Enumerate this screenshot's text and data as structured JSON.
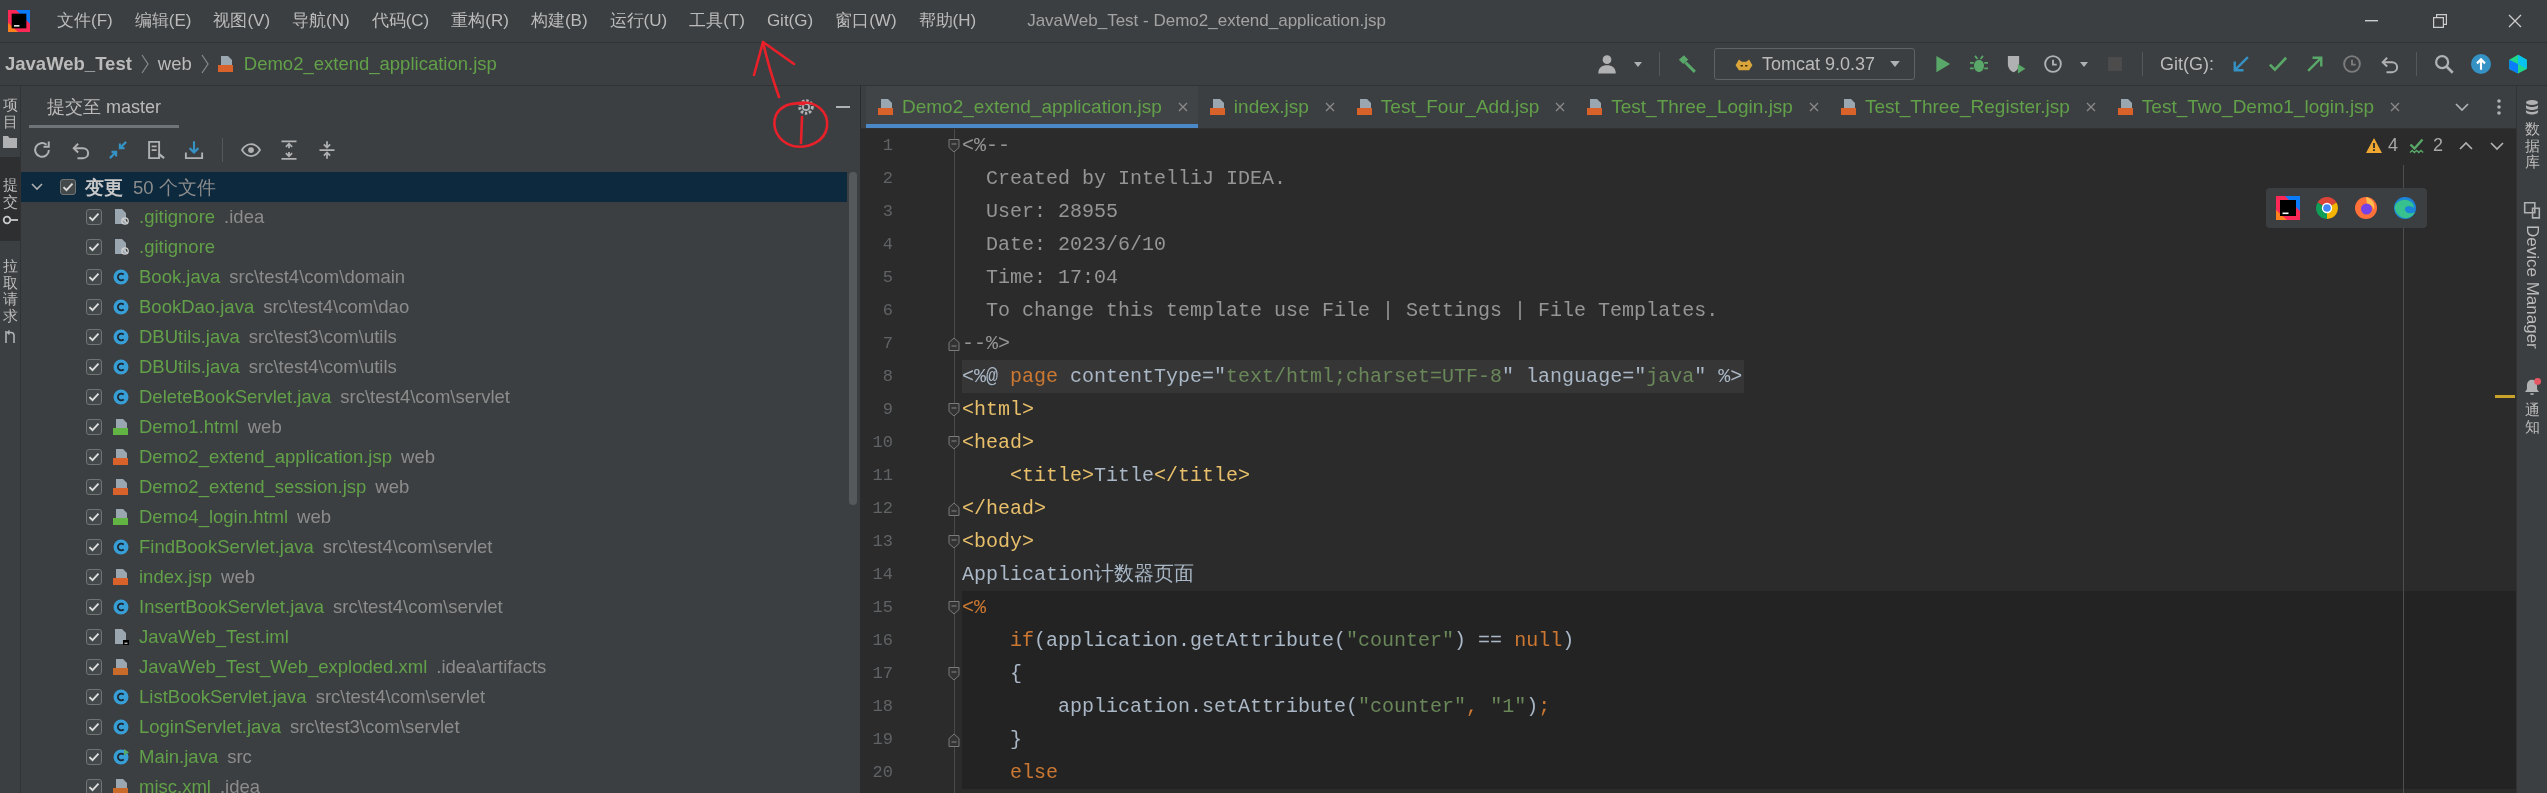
{
  "window": {
    "title": "JavaWeb_Test - Demo2_extend_application.jsp"
  },
  "menu": [
    "文件(F)",
    "编辑(E)",
    "视图(V)",
    "导航(N)",
    "代码(C)",
    "重构(R)",
    "构建(B)",
    "运行(U)",
    "工具(T)",
    "Git(G)",
    "窗口(W)",
    "帮助(H)"
  ],
  "breadcrumb": [
    {
      "label": "JavaWeb_Test",
      "kind": "project"
    },
    {
      "label": "web",
      "kind": "folder"
    },
    {
      "label": "Demo2_extend_application.jsp",
      "kind": "jsp"
    }
  ],
  "toolbar": {
    "run_config": "Tomcat 9.0.37",
    "run_buttons": [
      {
        "kind": "run",
        "disabled": false
      },
      {
        "kind": "debug",
        "disabled": false
      },
      {
        "kind": "coverage",
        "disabled": false
      },
      {
        "kind": "profile",
        "disabled": false
      },
      {
        "kind": "stop",
        "disabled": true
      }
    ],
    "git_label": "Git(G):",
    "git_buttons": [
      {
        "kind": "update",
        "disabled": false
      },
      {
        "kind": "commit",
        "disabled": false
      },
      {
        "kind": "push",
        "disabled": false
      },
      {
        "kind": "history",
        "disabled": true
      },
      {
        "kind": "rollback",
        "disabled": false
      }
    ]
  },
  "left_strip": [
    {
      "label": "项目",
      "kind": "project",
      "selected": false
    },
    {
      "label": "提交",
      "kind": "commit",
      "selected": true
    },
    {
      "label": "拉取请求",
      "kind": "pull_requests",
      "selected": false
    }
  ],
  "commit_panel": {
    "tab": "提交至 master",
    "changes": {
      "label": "变更",
      "count": "50 个文件",
      "expanded": true,
      "checked": true,
      "selected": true,
      "children": [
        {
          "name": ".gitignore",
          "path": ".idea",
          "kind": "ignored",
          "checked": true,
          "selected": false
        },
        {
          "name": ".gitignore",
          "kind": "ignored",
          "checked": true,
          "selected": false
        },
        {
          "name": "Book.java",
          "path": "src\\test4\\com\\domain",
          "kind": "class",
          "checked": true,
          "selected": false
        },
        {
          "name": "BookDao.java",
          "path": "src\\test4\\com\\dao",
          "kind": "class",
          "checked": true,
          "selected": false
        },
        {
          "name": "DBUtils.java",
          "path": "src\\test3\\com\\utils",
          "kind": "class",
          "checked": true,
          "selected": false
        },
        {
          "name": "DBUtils.java",
          "path": "src\\test4\\com\\utils",
          "kind": "class",
          "checked": true,
          "selected": false
        },
        {
          "name": "DeleteBookServlet.java",
          "path": "src\\test4\\com\\servlet",
          "kind": "class",
          "checked": true,
          "selected": false
        },
        {
          "name": "Demo1.html",
          "path": "web",
          "kind": "html",
          "checked": true,
          "selected": false
        },
        {
          "name": "Demo2_extend_application.jsp",
          "path": "web",
          "kind": "jsp",
          "checked": true,
          "selected": false
        },
        {
          "name": "Demo2_extend_session.jsp",
          "path": "web",
          "kind": "jsp",
          "checked": true,
          "selected": false
        },
        {
          "name": "Demo4_login.html",
          "path": "web",
          "kind": "html",
          "checked": true,
          "selected": false
        },
        {
          "name": "FindBookServlet.java",
          "path": "src\\test4\\com\\servlet",
          "kind": "class",
          "checked": true,
          "selected": false
        },
        {
          "name": "index.jsp",
          "path": "web",
          "kind": "jsp",
          "checked": true,
          "selected": false
        },
        {
          "name": "InsertBookServlet.java",
          "path": "src\\test4\\com\\servlet",
          "kind": "class",
          "checked": true,
          "selected": false
        },
        {
          "name": "JavaWeb_Test.iml",
          "kind": "module",
          "checked": true,
          "selected": false
        },
        {
          "name": "JavaWeb_Test_Web_exploded.xml",
          "path": ".idea\\artifacts",
          "kind": "xml",
          "checked": true,
          "selected": false
        },
        {
          "name": "ListBookServlet.java",
          "path": "src\\test4\\com\\servlet",
          "kind": "class",
          "checked": true,
          "selected": false
        },
        {
          "name": "LoginServlet.java",
          "path": "src\\test3\\com\\servlet",
          "kind": "class",
          "checked": true,
          "selected": false
        },
        {
          "name": "Main.java",
          "path": "src",
          "kind": "main",
          "checked": true,
          "selected": false
        },
        {
          "name": "misc.xml",
          "path": ".idea",
          "kind": "xml",
          "checked": true,
          "selected": false
        }
      ]
    }
  },
  "editor": {
    "tabs": [
      {
        "label": "Demo2_extend_application.jsp",
        "selected": true
      },
      {
        "label": "index.jsp",
        "selected": false
      },
      {
        "label": "Test_Four_Add.jsp",
        "selected": false
      },
      {
        "label": "Test_Three_Login.jsp",
        "selected": false
      },
      {
        "label": "Test_Three_Register.jsp",
        "selected": false
      },
      {
        "label": "Test_Two_Demo1_login.jsp",
        "selected": false
      }
    ],
    "inspections": {
      "warnings": "4",
      "typos": "2"
    },
    "lines": [
      {
        "number": "1",
        "fold_start": true,
        "fold_end": false,
        "kind": "plain",
        "tokens": [
          {
            "kind": "comment",
            "text": "<%--"
          }
        ]
      },
      {
        "number": "2",
        "fold_start": false,
        "fold_end": false,
        "kind": "plain",
        "tokens": [
          {
            "kind": "comment",
            "text": "  Created by IntelliJ IDEA."
          }
        ]
      },
      {
        "number": "3",
        "fold_start": false,
        "fold_end": false,
        "kind": "plain",
        "tokens": [
          {
            "kind": "comment",
            "text": "  User: 28955"
          }
        ]
      },
      {
        "number": "4",
        "fold_start": false,
        "fold_end": false,
        "kind": "plain",
        "tokens": [
          {
            "kind": "comment",
            "text": "  Date: 2023/6/10"
          }
        ]
      },
      {
        "number": "5",
        "fold_start": false,
        "fold_end": false,
        "kind": "plain",
        "tokens": [
          {
            "kind": "comment",
            "text": "  Time: 17:04"
          }
        ]
      },
      {
        "number": "6",
        "fold_start": false,
        "fold_end": false,
        "kind": "plain",
        "tokens": [
          {
            "kind": "comment",
            "text": "  To change this template use File | Settings | File Templates."
          }
        ]
      },
      {
        "number": "7",
        "fold_start": false,
        "fold_end": true,
        "kind": "plain",
        "tokens": [
          {
            "kind": "comment",
            "text": "--%>"
          }
        ]
      },
      {
        "number": "8",
        "fold_start": false,
        "fold_end": false,
        "kind": "directive",
        "tokens": [
          {
            "kind": "text",
            "text": "<%@ "
          },
          {
            "kind": "keyword",
            "text": "page"
          },
          {
            "kind": "text",
            "text": " contentType=\""
          },
          {
            "kind": "string",
            "text": "text/html;charset=UTF-8"
          },
          {
            "kind": "text",
            "text": "\" language=\""
          },
          {
            "kind": "string",
            "text": "java"
          },
          {
            "kind": "text",
            "text": "\" %>"
          }
        ]
      },
      {
        "number": "9",
        "fold_start": true,
        "fold_end": false,
        "kind": "plain",
        "tokens": [
          {
            "kind": "tag",
            "text": "<html>"
          }
        ]
      },
      {
        "number": "10",
        "fold_start": true,
        "fold_end": false,
        "kind": "plain",
        "tokens": [
          {
            "kind": "tag",
            "text": "<head>"
          }
        ]
      },
      {
        "number": "11",
        "fold_start": false,
        "fold_end": false,
        "kind": "plain",
        "tokens": [
          {
            "kind": "tag",
            "text": "    <title>"
          },
          {
            "kind": "text",
            "text": "Title"
          },
          {
            "kind": "tag",
            "text": "</title>"
          }
        ]
      },
      {
        "number": "12",
        "fold_start": false,
        "fold_end": true,
        "kind": "plain",
        "tokens": [
          {
            "kind": "tag",
            "text": "</head>"
          }
        ]
      },
      {
        "number": "13",
        "fold_start": true,
        "fold_end": false,
        "kind": "plain",
        "tokens": [
          {
            "kind": "tag",
            "text": "<body>"
          }
        ]
      },
      {
        "number": "14",
        "fold_start": false,
        "fold_end": false,
        "kind": "plain",
        "tokens": [
          {
            "kind": "text",
            "text": "Application计数器页面"
          }
        ]
      },
      {
        "number": "15",
        "fold_start": true,
        "fold_end": false,
        "kind": "scriptlet",
        "tokens": [
          {
            "kind": "keyword",
            "text": "<%"
          }
        ]
      },
      {
        "number": "16",
        "fold_start": false,
        "fold_end": false,
        "kind": "scriptlet",
        "tokens": [
          {
            "kind": "keyword",
            "text": "    if"
          },
          {
            "kind": "text",
            "text": "(application.getAttribute("
          },
          {
            "kind": "string",
            "text": "\"counter\""
          },
          {
            "kind": "text",
            "text": ") == "
          },
          {
            "kind": "keyword",
            "text": "null"
          },
          {
            "kind": "text",
            "text": ")"
          }
        ]
      },
      {
        "number": "17",
        "fold_start": true,
        "fold_end": false,
        "kind": "scriptlet",
        "tokens": [
          {
            "kind": "text",
            "text": "    {"
          }
        ]
      },
      {
        "number": "18",
        "fold_start": false,
        "fold_end": false,
        "kind": "scriptlet",
        "tokens": [
          {
            "kind": "text",
            "text": "        application.setAttribute("
          },
          {
            "kind": "string",
            "text": "\"counter\""
          },
          {
            "kind": "keyword",
            "text": ", "
          },
          {
            "kind": "string",
            "text": "\"1\""
          },
          {
            "kind": "text",
            "text": ")"
          },
          {
            "kind": "keyword",
            "text": ";"
          }
        ]
      },
      {
        "number": "19",
        "fold_start": false,
        "fold_end": true,
        "kind": "scriptlet",
        "tokens": [
          {
            "kind": "text",
            "text": "    }"
          }
        ]
      },
      {
        "number": "20",
        "fold_start": false,
        "fold_end": false,
        "kind": "scriptlet",
        "tokens": [
          {
            "kind": "keyword",
            "text": "    else"
          }
        ]
      }
    ]
  },
  "right_strip": [
    {
      "label": "数据库",
      "kind": "database",
      "alert": false
    },
    {
      "label": "Device Manager",
      "kind": "devices",
      "alert": false
    },
    {
      "label": "通知",
      "kind": "notifications",
      "alert": true
    }
  ]
}
